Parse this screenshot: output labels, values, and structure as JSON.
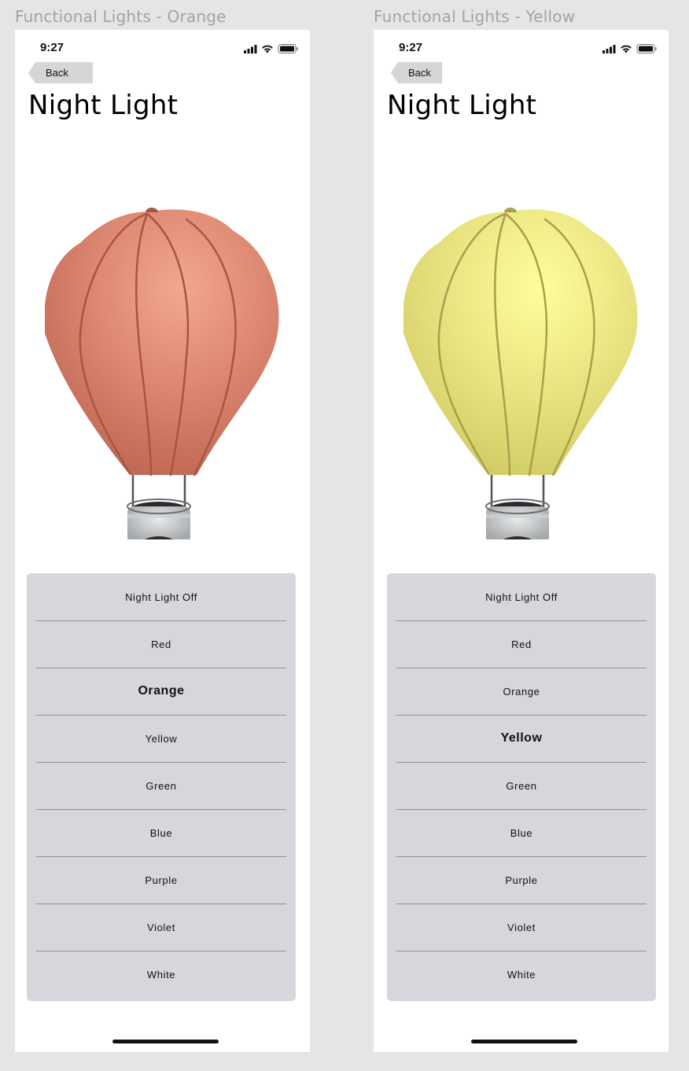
{
  "frames": [
    {
      "title": "Functional Lights - Orange",
      "status_time": "9:27",
      "back_label": "Back",
      "page_title": "Night Light",
      "balloon_color": {
        "light": "#f3a78e",
        "mid": "#dc8771",
        "dark": "#bd6652",
        "seam": "#a85543"
      },
      "selected": "Orange",
      "options": [
        "Night Light Off",
        "Red",
        "Orange",
        "Yellow",
        "Green",
        "Blue",
        "Purple",
        "Violet",
        "White"
      ]
    },
    {
      "title": "Functional Lights - Yellow",
      "status_time": "9:27",
      "back_label": "Back",
      "page_title": "Night Light",
      "balloon_color": {
        "light": "#fffe9c",
        "mid": "#eae582",
        "dark": "#cfcb63",
        "seam": "#a7a04c"
      },
      "selected": "Yellow",
      "options": [
        "Night Light Off",
        "Red",
        "Orange",
        "Yellow",
        "Green",
        "Blue",
        "Purple",
        "Violet",
        "White"
      ]
    }
  ]
}
